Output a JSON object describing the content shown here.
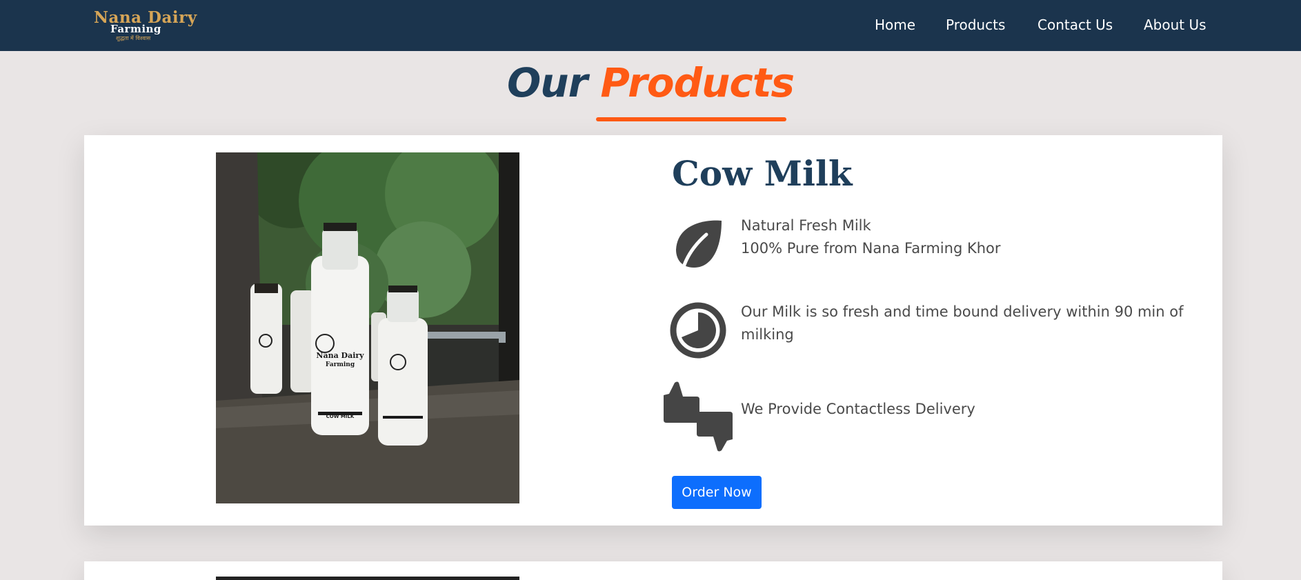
{
  "brand": {
    "line1": "Nana Dairy",
    "line2": "Farming",
    "tagline": "शुद्धता में विश्वास"
  },
  "nav": {
    "items": [
      {
        "label": "Home"
      },
      {
        "label": "Products"
      },
      {
        "label": "Contact Us"
      },
      {
        "label": "About Us"
      }
    ]
  },
  "page": {
    "heading_part1": "Our",
    "heading_part2": "Products"
  },
  "product": {
    "title": "Cow Milk",
    "features": [
      {
        "icon": "leaf-icon",
        "lines": [
          "Natural Fresh Milk",
          "100% Pure from Nana Farming Khor"
        ]
      },
      {
        "icon": "clock-icon",
        "text": "Our Milk is so fresh and time bound delivery within 90 min of milking"
      },
      {
        "icon": "thumbs-icon",
        "text": "We Provide Contactless Delivery"
      }
    ],
    "order_button": "Order Now",
    "image": {
      "bottle_brand_line1": "Nana Dairy",
      "bottle_brand_line2": "Farming",
      "bottle_label": "COW MILK"
    }
  },
  "colors": {
    "navbar": "#1b344d",
    "accent": "#ff5a14",
    "title": "#1f3f5b",
    "button": "#0d6efd",
    "page_bg": "#e9e5e5"
  }
}
